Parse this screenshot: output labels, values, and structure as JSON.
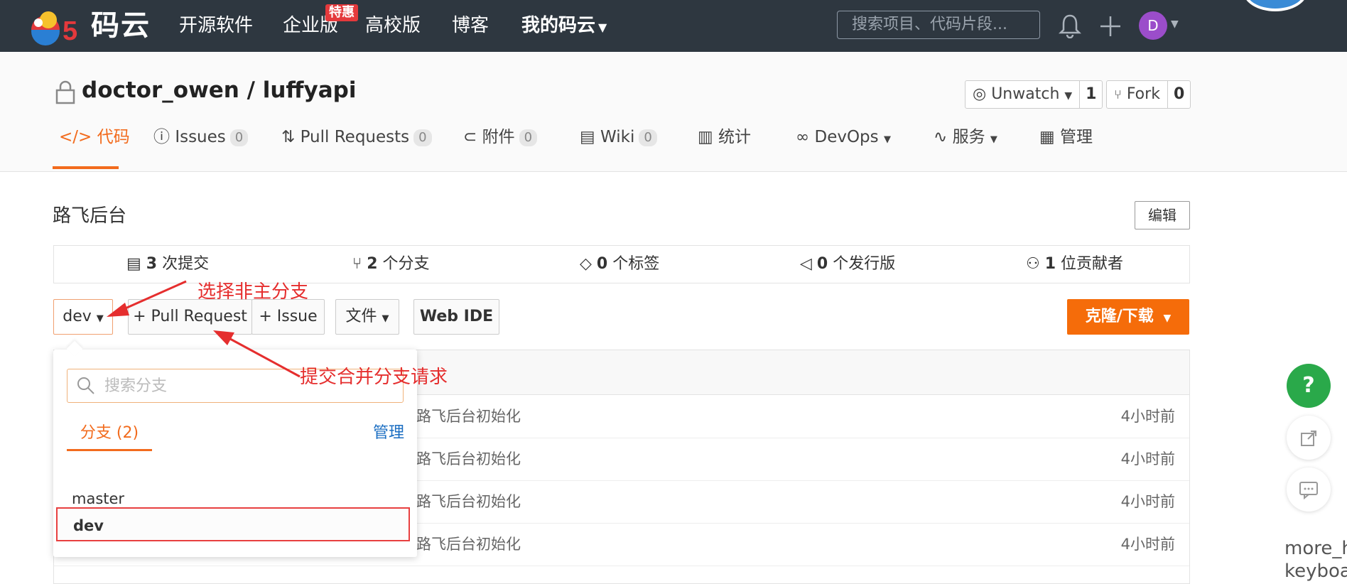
{
  "nav": {
    "logo_text": "码云",
    "items": [
      "开源软件",
      "企业版",
      "高校版",
      "博客",
      "我的码云"
    ],
    "badge": "特惠",
    "search_placeholder": "搜索项目、代码片段...",
    "avatar_initial": "D"
  },
  "repo": {
    "title": "doctor_owen / luffyapi",
    "unwatch_label": "Unwatch",
    "unwatch_count": "1",
    "fork_label": "Fork",
    "fork_count": "0"
  },
  "tabs": [
    {
      "label": "代码",
      "count": ""
    },
    {
      "label": "Issues",
      "count": "0"
    },
    {
      "label": "Pull Requests",
      "count": "0"
    },
    {
      "label": "附件",
      "count": "0"
    },
    {
      "label": "Wiki",
      "count": "0"
    },
    {
      "label": "统计",
      "count": ""
    },
    {
      "label": "DevOps",
      "count": ""
    },
    {
      "label": "服务",
      "count": ""
    },
    {
      "label": "管理",
      "count": ""
    }
  ],
  "description": "路飞后台",
  "edit_label": "编辑",
  "stats": [
    {
      "num": "3",
      "label": "次提交"
    },
    {
      "num": "2",
      "label": "个分支"
    },
    {
      "num": "0",
      "label": "个标签"
    },
    {
      "num": "0",
      "label": "个发行版"
    },
    {
      "num": "1",
      "label": "位贡献者"
    }
  ],
  "controls": {
    "branch": "dev",
    "pull_request": "+ Pull Request",
    "issue": "+ Issue",
    "file": "文件",
    "web_ide": "Web IDE",
    "clone": "克隆/下载"
  },
  "files": [
    {
      "msg": "路飞后台初始化",
      "time": "4小时前"
    },
    {
      "msg": "路飞后台初始化",
      "time": "4小时前"
    },
    {
      "msg": "路飞后台初始化",
      "time": "4小时前"
    },
    {
      "msg": "路飞后台初始化",
      "time": "4小时前"
    }
  ],
  "branch_dropdown": {
    "search_placeholder": "搜索分支",
    "tab": "分支 (2)",
    "manage": "管理",
    "branches": [
      "master",
      "dev"
    ]
  },
  "annotations": {
    "select_branch": "选择非主分支",
    "submit_pr": "提交合并分支请求"
  },
  "right_panel": {
    "help": "?",
    "more_text": "more_h",
    "more_text2": "keyboa"
  },
  "colors": {
    "nav_bg": "#2e3740",
    "accent": "#f26b1d",
    "clone_bg": "#f56c0a",
    "annotation": "#e52e2e",
    "help_green": "#2aa94a"
  }
}
